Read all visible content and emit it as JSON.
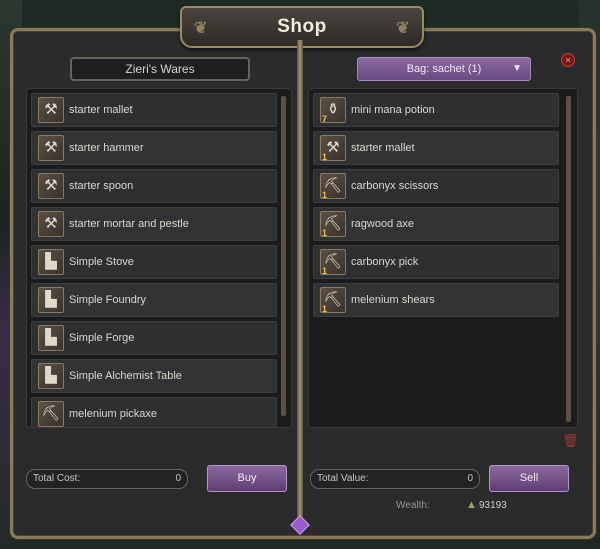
{
  "window": {
    "title": "Shop",
    "close_icon": "×"
  },
  "vendor": {
    "name": "Zieri's Wares",
    "items": [
      {
        "label": "starter mallet",
        "icon": "mallet-icon",
        "glyph": "⚒"
      },
      {
        "label": "starter hammer",
        "icon": "hammer-icon",
        "glyph": "⚒"
      },
      {
        "label": "starter spoon",
        "icon": "spoon-icon",
        "glyph": "⚒"
      },
      {
        "label": "starter mortar and pestle",
        "icon": "mortar-icon",
        "glyph": "⚒"
      },
      {
        "label": "Simple Stove",
        "icon": "anvil-icon",
        "glyph": "▙"
      },
      {
        "label": "Simple Foundry",
        "icon": "anvil-icon",
        "glyph": "▙"
      },
      {
        "label": "Simple Forge",
        "icon": "anvil-icon",
        "glyph": "▙"
      },
      {
        "label": "Simple Alchemist Table",
        "icon": "anvil-icon",
        "glyph": "▙"
      },
      {
        "label": "melenium pickaxe",
        "icon": "pickaxe-icon",
        "glyph": "⛏"
      }
    ],
    "total_label": "Total Cost:",
    "total_value": "0",
    "buy_label": "Buy"
  },
  "bag": {
    "select_label": "Bag: sachet (1)",
    "chevron_icon": "▼",
    "items": [
      {
        "label": "mini mana potion",
        "icon": "potion-icon",
        "glyph": "⚱",
        "qty": "7"
      },
      {
        "label": "starter mallet",
        "icon": "mallet-icon",
        "glyph": "⚒",
        "qty": "1"
      },
      {
        "label": "carbonyx scissors",
        "icon": "pickaxe-icon",
        "glyph": "⛏",
        "qty": "1"
      },
      {
        "label": "ragwood axe",
        "icon": "pickaxe-icon",
        "glyph": "⛏",
        "qty": "1"
      },
      {
        "label": "carbonyx pick",
        "icon": "pickaxe-icon",
        "glyph": "⛏",
        "qty": "1"
      },
      {
        "label": "melenium shears",
        "icon": "pickaxe-icon",
        "glyph": "⛏",
        "qty": "1"
      }
    ],
    "trash_icon": "🗑",
    "total_label": "Total Value:",
    "total_value": "0",
    "sell_label": "Sell"
  },
  "wealth": {
    "label": "Wealth:",
    "icon": "▲",
    "value": "93193"
  },
  "colors": {
    "accent_purple": "#6a4a82",
    "frame_gold": "#8a7a5c",
    "panel_bg": "#2b2b2d",
    "qty_yellow": "#f0c040"
  }
}
